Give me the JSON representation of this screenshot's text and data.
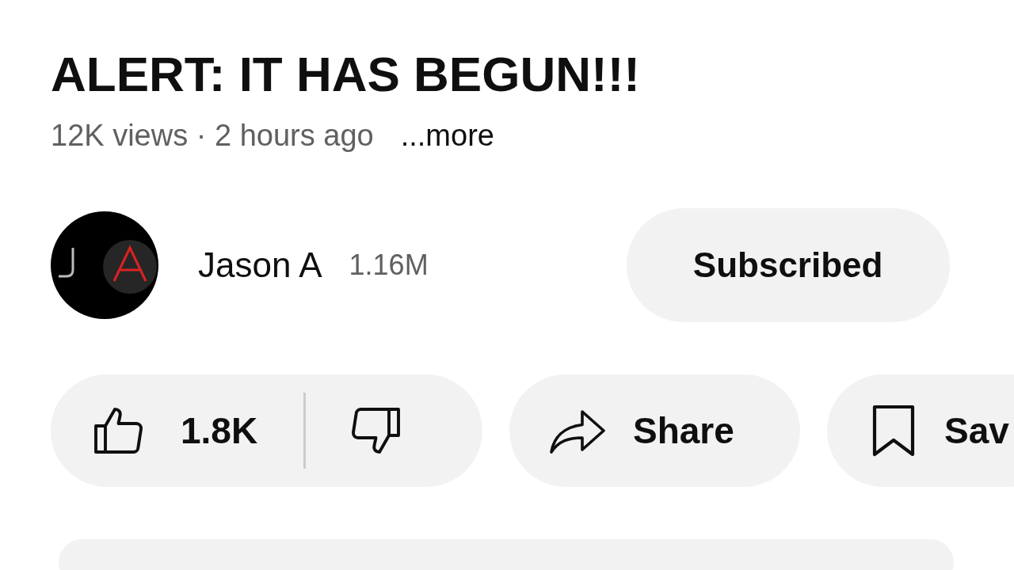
{
  "video": {
    "title": "ALERT: IT HAS BEGUN!!!",
    "meta": "12K views · 2 hours ago",
    "more": "...more"
  },
  "channel": {
    "name": "Jason A",
    "subscribers": "1.16M",
    "subscribe_button": {
      "label": "Subscribed",
      "subscribed": true
    }
  },
  "actions": {
    "likes": "1.8K",
    "share": "Share",
    "save": "Sav"
  }
}
